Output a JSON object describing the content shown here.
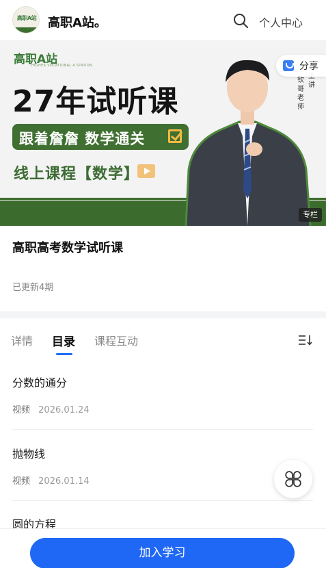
{
  "header": {
    "logo_text": "高职A站",
    "site_name": "高职A站。",
    "user_center_label": "个人中心"
  },
  "banner": {
    "brand_logo": "高职A站",
    "brand_sub": "HIGHER VOCATIONAL A STATION",
    "title": "27年试听课",
    "slogan": "跟着詹詹 数学通关",
    "line3": "线上课程【数学】",
    "vertical_col1": [
      "主",
      "讲"
    ],
    "vertical_col2": [
      "钦",
      "哥",
      "老",
      "师"
    ],
    "badge": "专栏",
    "share_label": "分享"
  },
  "course": {
    "title": "高职高考数学试听课",
    "updated": "已更新4期"
  },
  "tabs": [
    {
      "label": "详情"
    },
    {
      "label": "目录"
    },
    {
      "label": "课程互动"
    }
  ],
  "items": [
    {
      "title": "分数的通分",
      "type": "视频",
      "date": "2026.01.24"
    },
    {
      "title": "抛物线",
      "type": "视频",
      "date": "2026.01.14"
    },
    {
      "title": "圆的方程",
      "type": "",
      "date": ""
    }
  ],
  "bottom": {
    "join_label": "加入学习"
  },
  "colors": {
    "accent": "#1f67f5",
    "brand_green": "#3c6b2e"
  },
  "icons": {
    "search": "search-icon",
    "sort": "sort-icon",
    "floating": "clover-menu-icon",
    "share": "share-icon"
  }
}
